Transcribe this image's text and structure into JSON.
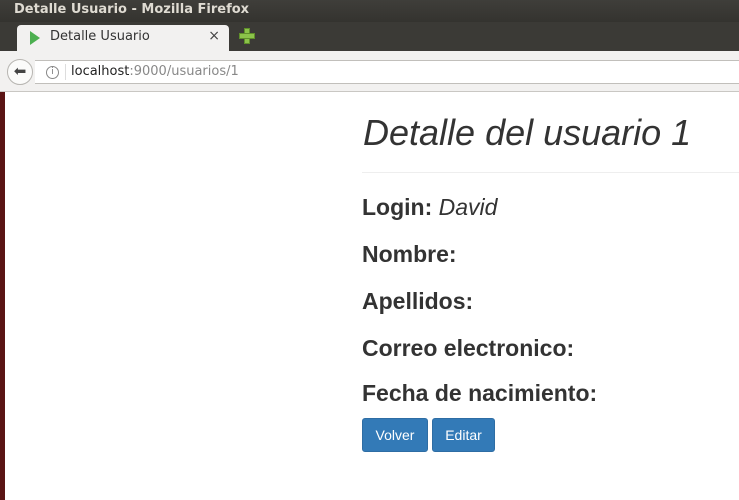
{
  "window": {
    "title": "Detalle Usuario - Mozilla Firefox"
  },
  "tab": {
    "title": "Detalle Usuario",
    "close_glyph": "×"
  },
  "navbar": {
    "back_glyph": "⬅",
    "url_host": "localhost",
    "url_rest": ":9000/usuarios/1"
  },
  "page": {
    "title": "Detalle del usuario 1",
    "fields": [
      {
        "label": "Login:",
        "value": "David"
      },
      {
        "label": "Nombre:",
        "value": ""
      },
      {
        "label": "Apellidos:",
        "value": ""
      },
      {
        "label": "Correo electronico:",
        "value": ""
      },
      {
        "label": "Fecha de nacimiento:",
        "value": ""
      }
    ],
    "buttons": {
      "volver": "Volver",
      "editar": "Editar"
    }
  },
  "colors": {
    "primary_button": "#337ab7",
    "text": "#333333"
  }
}
